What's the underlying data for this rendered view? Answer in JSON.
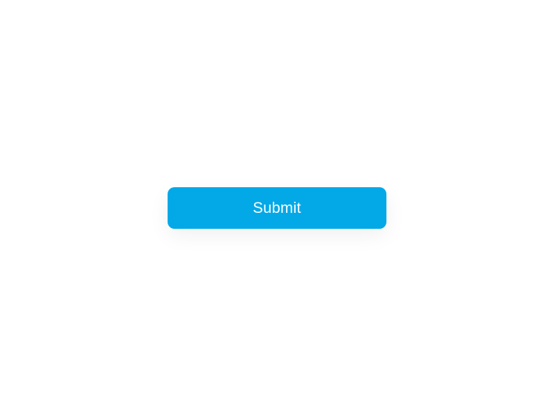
{
  "button": {
    "label": "Submit"
  }
}
